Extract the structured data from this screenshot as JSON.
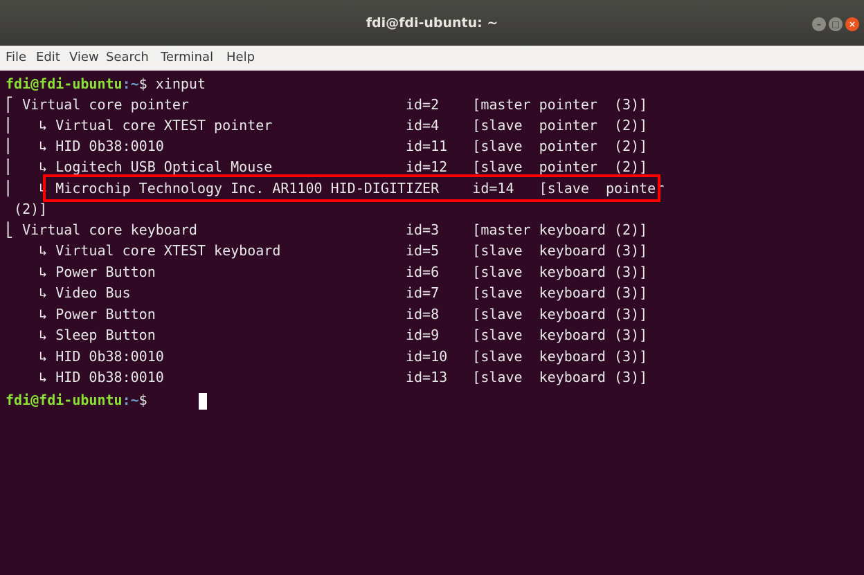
{
  "window": {
    "title": "fdi@fdi-ubuntu: ~",
    "buttons": {
      "minimize_icon": "minimize-icon",
      "maximize_icon": "maximize-icon",
      "close_icon": "close-icon"
    }
  },
  "menubar": {
    "items": [
      "File",
      "Edit",
      "View",
      "Search",
      "Terminal",
      "Help"
    ]
  },
  "terminal": {
    "prompt_user": "fdi@fdi-ubuntu",
    "prompt_path": ":~",
    "prompt_symbol": "$ ",
    "command": "xinput",
    "lines": [
      "⎡ Virtual core pointer                          id=2    [master pointer  (3)]",
      "⎜   ↳ Virtual core XTEST pointer                id=4    [slave  pointer  (2)]",
      "⎜   ↳ HID 0b38:0010                             id=11   [slave  pointer  (2)]",
      "⎜   ↳ Logitech USB Optical Mouse                id=12   [slave  pointer  (2)]",
      "⎜   ↳ Microchip Technology Inc. AR1100 HID-DIGITIZER    id=14   [slave  pointer",
      " (2)]",
      "⎣ Virtual core keyboard                         id=3    [master keyboard (2)]",
      "    ↳ Virtual core XTEST keyboard               id=5    [slave  keyboard (3)]",
      "    ↳ Power Button                              id=6    [slave  keyboard (3)]",
      "    ↳ Video Bus                                 id=7    [slave  keyboard (3)]",
      "    ↳ Power Button                              id=8    [slave  keyboard (3)]",
      "    ↳ Sleep Button                              id=9    [slave  keyboard (3)]",
      "    ↳ HID 0b38:0010                             id=10   [slave  keyboard (3)]",
      "    ↳ HID 0b38:0010                             id=13   [slave  keyboard (3)]"
    ],
    "highlighted_line_index": 4
  },
  "colors": {
    "terminal_bg": "#300a24",
    "prompt_user": "#8ae234",
    "prompt_path": "#729fcf",
    "highlight": "#ff0000",
    "close_button": "#e95420"
  }
}
